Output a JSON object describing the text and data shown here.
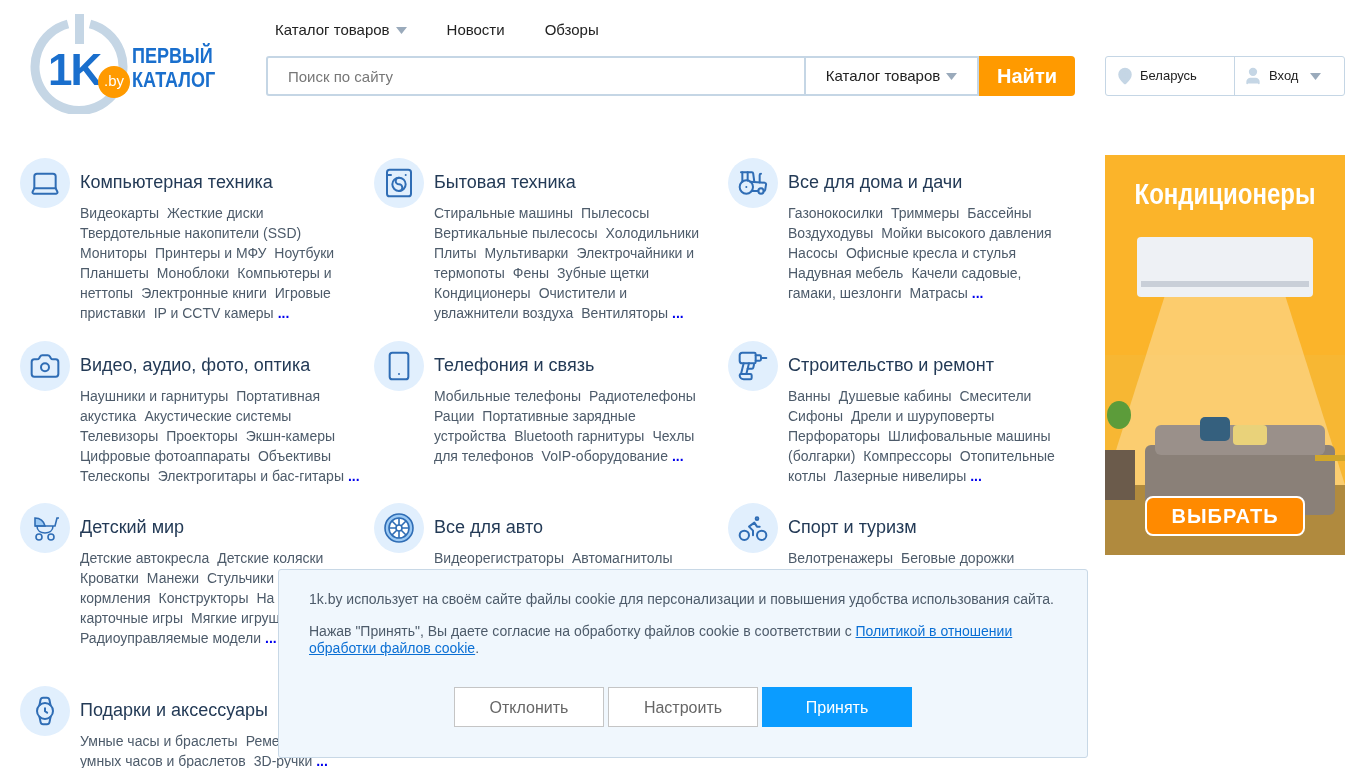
{
  "logo": {
    "mark": "1K",
    "domain": ".by",
    "line1": "ПЕРВЫЙ",
    "line2": "КАТАЛОГ"
  },
  "nav": [
    {
      "label": "Каталог товаров",
      "dropdown": true
    },
    {
      "label": "Новости",
      "dropdown": false
    },
    {
      "label": "Обзоры",
      "dropdown": false
    }
  ],
  "search": {
    "placeholder": "Поиск по сайту",
    "scope": "Каталог товаров",
    "button": "Найти"
  },
  "region": "Беларусь",
  "login": "Вход",
  "categories": [
    {
      "title": "Компьютерная техника",
      "lines": [
        [
          "Видеокарты",
          "Жесткие диски"
        ],
        [
          "Твердотельные накопители (SSD)"
        ],
        [
          "Мониторы",
          "Принтеры и МФУ",
          "Ноутбуки"
        ],
        [
          "Планшеты",
          "Моноблоки",
          "Компьютеры и"
        ],
        [
          "неттопы",
          "Электронные книги",
          "Игровые"
        ],
        [
          "приставки",
          "IP и CCTV камеры"
        ]
      ],
      "more": "..."
    },
    {
      "title": "Бытовая техника",
      "lines": [
        [
          "Стиральные машины",
          "Пылесосы"
        ],
        [
          "Вертикальные пылесосы",
          "Холодильники"
        ],
        [
          "Плиты",
          "Мультиварки",
          "Электрочайники и"
        ],
        [
          "термопоты",
          "Фены",
          "Зубные щетки"
        ],
        [
          "Кондиционеры",
          "Очистители и"
        ],
        [
          "увлажнители воздуха",
          "Вентиляторы"
        ]
      ],
      "more": "..."
    },
    {
      "title": "Все для дома и дачи",
      "lines": [
        [
          "Газонокосилки",
          "Триммеры",
          "Бассейны"
        ],
        [
          "Воздуходувы",
          "Мойки высокого давления"
        ],
        [
          "Насосы",
          "Офисные кресла и стулья"
        ],
        [
          "Надувная мебель",
          "Качели садовые,"
        ],
        [
          "гамаки, шезлонги",
          "Матрасы"
        ]
      ],
      "more": "..."
    },
    {
      "title": "Видео, аудио, фото, оптика",
      "lines": [
        [
          "Наушники и гарнитуры",
          "Портативная"
        ],
        [
          "акустика",
          "Акустические системы"
        ],
        [
          "Телевизоры",
          "Проекторы",
          "Экшн-камеры"
        ],
        [
          "Цифровые фотоаппараты",
          "Объективы"
        ],
        [
          "Телескопы",
          "Электрогитары и бас-гитары"
        ]
      ],
      "more": "..."
    },
    {
      "title": "Телефония и связь",
      "lines": [
        [
          "Мобильные телефоны",
          "Радиотелефоны"
        ],
        [
          "Рации",
          "Портативные зарядные"
        ],
        [
          "устройства",
          "Bluetooth гарнитуры",
          "Чехлы"
        ],
        [
          "для телефонов",
          "VoIP-оборудование"
        ]
      ],
      "more": "..."
    },
    {
      "title": "Строительство и ремонт",
      "lines": [
        [
          "Ванны",
          "Душевые кабины",
          "Смесители"
        ],
        [
          "Сифоны",
          "Дрели и шуруповерты"
        ],
        [
          "Перфораторы",
          "Шлифовальные машины"
        ],
        [
          "(болгарки)",
          "Компрессоры",
          "Отопительные"
        ],
        [
          "котлы",
          "Лазерные нивелиры"
        ]
      ],
      "more": "..."
    },
    {
      "title": "Детский мир",
      "lines": [
        [
          "Детские автокресла",
          "Детские коляски"
        ],
        [
          "Кроватки",
          "Манежи",
          "Стульчики"
        ],
        [
          "кормления",
          "Конструкторы",
          "На"
        ],
        [
          "карточные игры",
          "Мягкие игруш"
        ],
        [
          "Радиоуправляемые модели"
        ]
      ],
      "more": "..."
    },
    {
      "title": "Все для авто",
      "lines": [
        [
          "Видеорегистраторы",
          "Автомагнитолы"
        ]
      ]
    },
    {
      "title": "Спорт и туризм",
      "lines": [
        [
          "Велотренажеры",
          "Беговые дорожки"
        ]
      ]
    },
    {
      "title": "Подарки и аксессуары",
      "lines": [
        [
          "Умные часы и браслеты",
          "Реме"
        ],
        [
          "умных часов и браслетов",
          "3D-ручки"
        ]
      ],
      "more": "..."
    }
  ],
  "banner": {
    "title": "Кондиционеры",
    "button": "ВЫБРАТЬ"
  },
  "cookie": {
    "text": "1k.by использует на своём сайте файлы cookie для персонализации и повышения удобства использования сайта.",
    "consent": "Нажав \"Принять\", Вы даете согласие на обработку файлов cookie в соответствии с ",
    "link": [
      "Политикой в отношении",
      "обработки файлов cookie"
    ],
    "after": ".",
    "buttons": [
      {
        "label": "Отклонить",
        "kind": "secondary"
      },
      {
        "label": "Настроить",
        "kind": "secondary"
      },
      {
        "label": "Принять",
        "kind": "primary"
      }
    ]
  }
}
